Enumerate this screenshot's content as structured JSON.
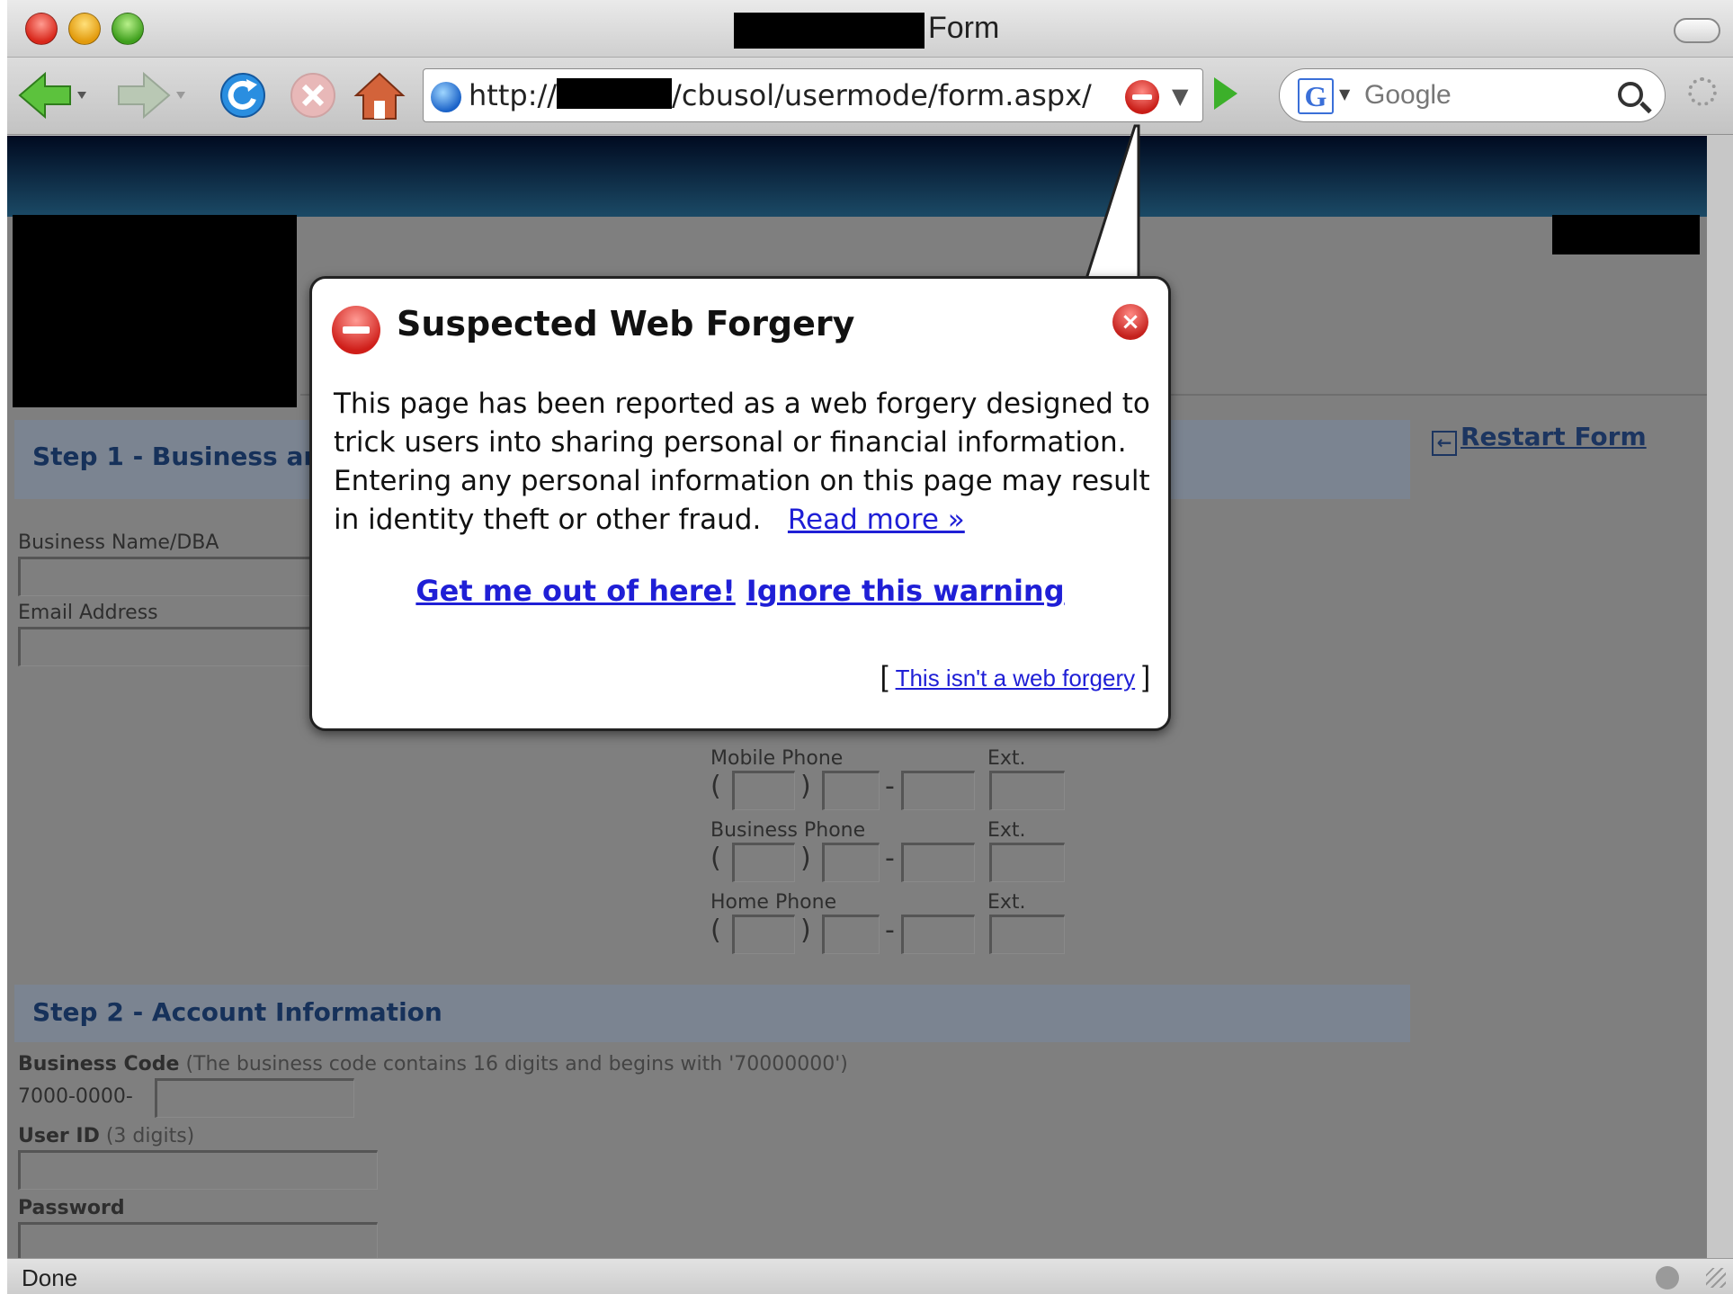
{
  "window": {
    "title": "Form"
  },
  "toolbar": {
    "url_prefix": "http://",
    "url_suffix": "/cbusol/usermode/form.aspx/",
    "search_placeholder": "Google"
  },
  "page": {
    "restart_label": "Restart Form",
    "step1_title": "Step 1 - Business and",
    "step2_title": "Step 2 - Account Information",
    "fields": {
      "business_name": "Business Name/DBA",
      "email": "Email Address",
      "mobile_phone": "Mobile Phone",
      "business_phone": "Business Phone",
      "home_phone": "Home Phone",
      "ext": "Ext.",
      "business_code": "Business Code",
      "business_code_hint": "(The business code contains 16 digits and begins with '70000000')",
      "business_code_prefix": "7000-0000-",
      "user_id": "User ID",
      "user_id_hint": "(3 digits)",
      "password": "Password"
    }
  },
  "popup": {
    "title": "Suspected Web Forgery",
    "body": "This page has been reported as a web forgery designed to trick users into sharing personal or financial information. Entering any personal information on this page may result in identity theft or other fraud.",
    "read_more": "Read more »",
    "get_out": "Get me out of here!",
    "ignore": "Ignore this warning",
    "not_forgery": "This isn't a web forgery",
    "bracket_open": "[",
    "bracket_close": "]"
  },
  "status": {
    "text": "Done"
  },
  "colors": {
    "link": "#1f1fd6",
    "step_title": "#16315a",
    "warning_red": "#cf1e19"
  }
}
